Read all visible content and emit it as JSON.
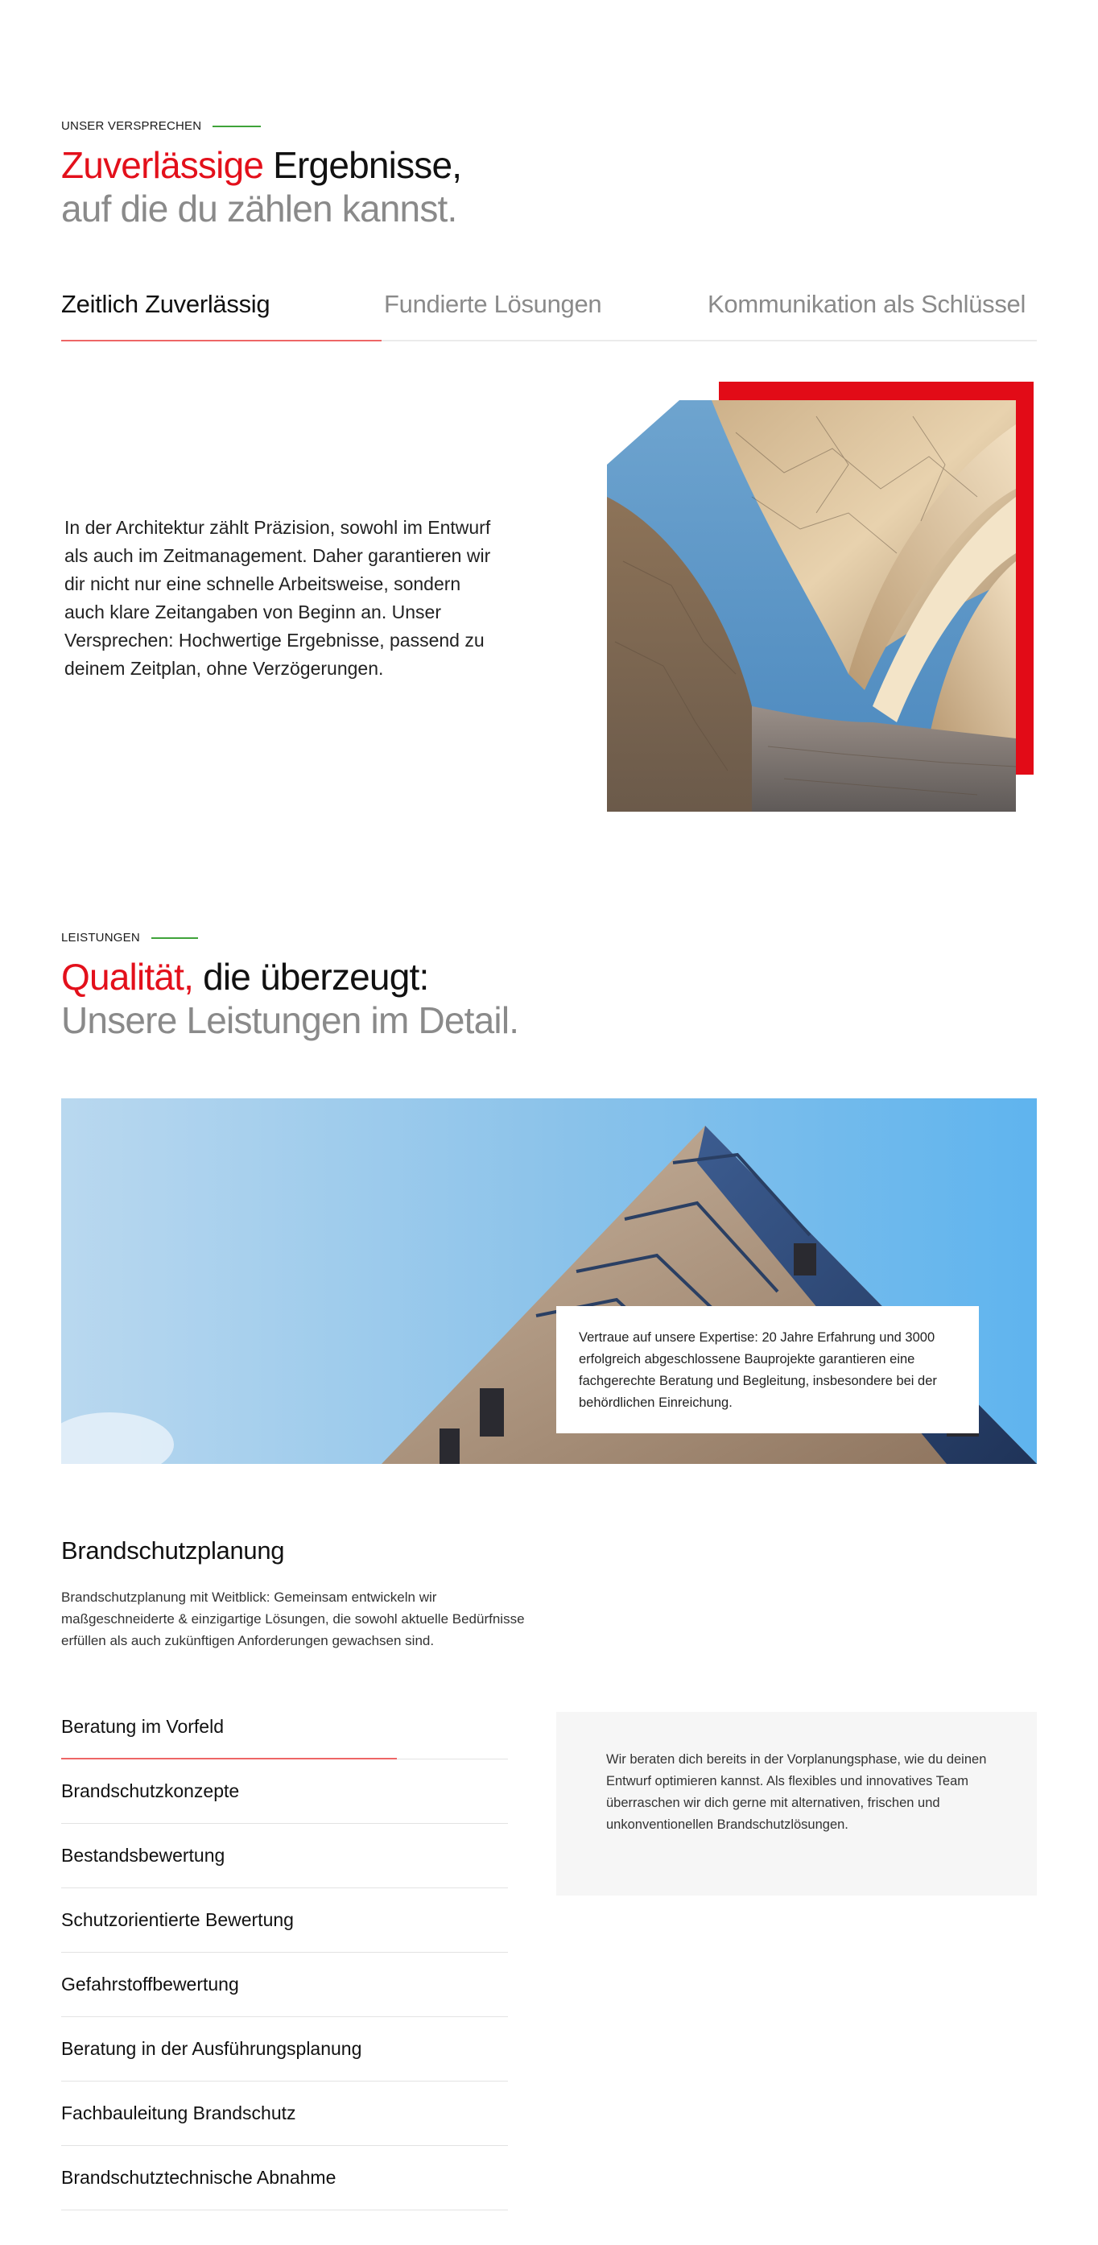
{
  "promise": {
    "eyebrow": "UNSER VERSPRECHEN",
    "title_red": "Zuverlässige",
    "title_dark": " Ergebnisse,",
    "title_grey": "auf die du zählen kannst.",
    "tabs": [
      {
        "label": "Zeitlich Zuverlässig",
        "active": true
      },
      {
        "label": "Fundierte Lösungen",
        "active": false
      },
      {
        "label": "Kommunikation als Schlüssel",
        "active": false
      }
    ],
    "text": "In der Architektur zählt Präzision, sowohl im Entwurf als auch im Zeitmanagement. Daher garantieren wir dir nicht nur eine schnelle Arbeitsweise, sondern auch klare Zeitangaben von Beginn an. Unser Versprechen: Hochwertige Ergebnisse, passend zu deinem Zeitplan, ohne Verzögerungen."
  },
  "services": {
    "eyebrow": "LEISTUNGEN",
    "title_red": "Qualität,",
    "title_dark": " die überzeugt:",
    "title_grey": "Unsere Leistungen im Detail.",
    "banner_text": "Vertraue auf unsere Expertise: 20 Jahre Erfahrung und 3000 erfolgreich abgeschlossene Bauprojekte garantieren eine fachgerechte Beratung und Begleitung, insbesondere bei der behördlichen Einreichung.",
    "section_title": "Brandschutzplanung",
    "section_text": "Brandschutzplanung mit Weitblick: Gemeinsam entwickeln wir maßgeschneiderte & einzigartige Lösungen, die sowohl aktuelle Bedürfnisse erfüllen als auch zukünftigen Anforderungen gewachsen sind.",
    "items": [
      {
        "label": "Beratung im Vorfeld",
        "active": true
      },
      {
        "label": "Brandschutzkonzepte",
        "active": false
      },
      {
        "label": "Bestandsbewertung",
        "active": false
      },
      {
        "label": "Schutzorientierte Bewertung",
        "active": false
      },
      {
        "label": "Gefahrstoffbewertung",
        "active": false
      },
      {
        "label": "Beratung in der Ausführungsplanung",
        "active": false
      },
      {
        "label": "Fachbauleitung Brandschutz",
        "active": false
      },
      {
        "label": "Brandschutztechnische Abnahme",
        "active": false
      }
    ],
    "info_text": "Wir beraten dich bereits in der Vorplanungsphase, wie du deinen Entwurf optimieren kannst. Als flexibles und innovatives Team überraschen wir dich gerne mit alternativen, frischen und unkonventionellen Brandschutzlösungen."
  },
  "colors": {
    "accent_red": "#e3101b",
    "accent_green": "#3fa33a",
    "muted_text": "#8a8a8a"
  }
}
